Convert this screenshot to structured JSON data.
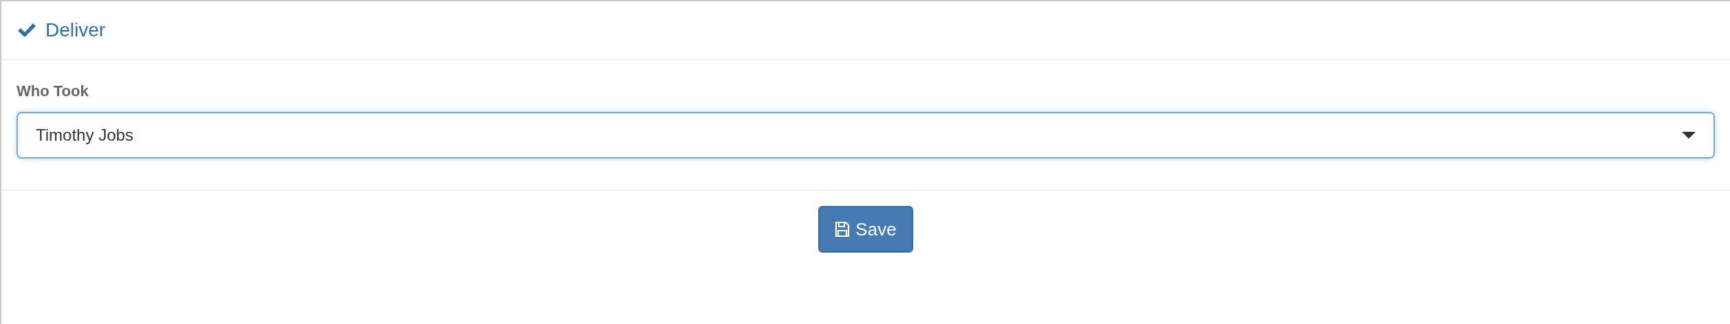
{
  "header": {
    "title": "Deliver"
  },
  "field": {
    "label": "Who Took",
    "value": "Timothy Jobs"
  },
  "buttons": [
    {
      "label": "Save",
      "kind": "save"
    }
  ]
}
